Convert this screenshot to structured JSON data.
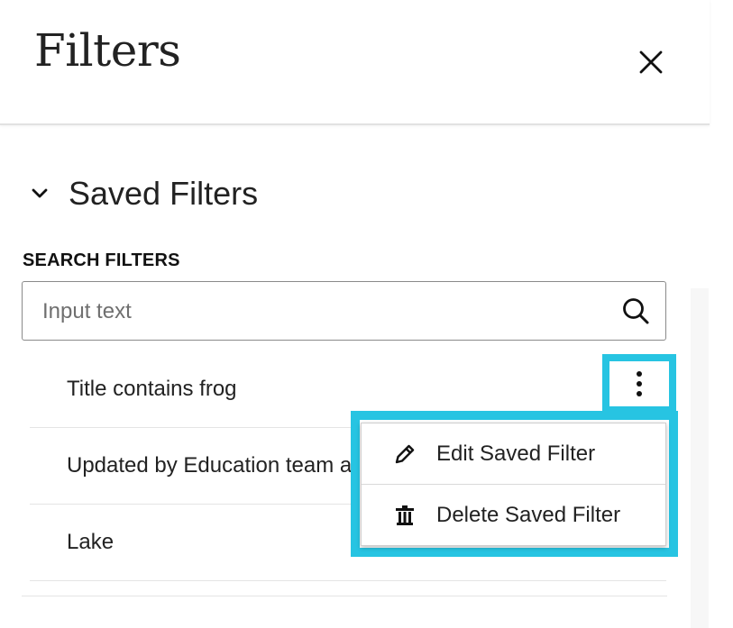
{
  "header": {
    "title": "Filters",
    "close_icon": "close-icon"
  },
  "saved_filters": {
    "section_title": "Saved Filters",
    "chevron_icon": "chevron-down-icon",
    "search_label": "SEARCH FILTERS",
    "search_placeholder": "Input text",
    "search_value": "",
    "search_icon": "search-icon",
    "items": [
      {
        "label": "Title contains frog"
      },
      {
        "label": "Updated by Education team a"
      },
      {
        "label": "Lake"
      }
    ]
  },
  "context_menu": {
    "kebab_icon": "kebab-menu-icon",
    "items": [
      {
        "label": "Edit Saved Filter",
        "icon": "pencil-icon"
      },
      {
        "label": "Delete Saved Filter",
        "icon": "trash-icon"
      }
    ]
  },
  "colors": {
    "highlight": "#27c4e2",
    "text": "#222222",
    "divider": "#e4e4e4"
  }
}
